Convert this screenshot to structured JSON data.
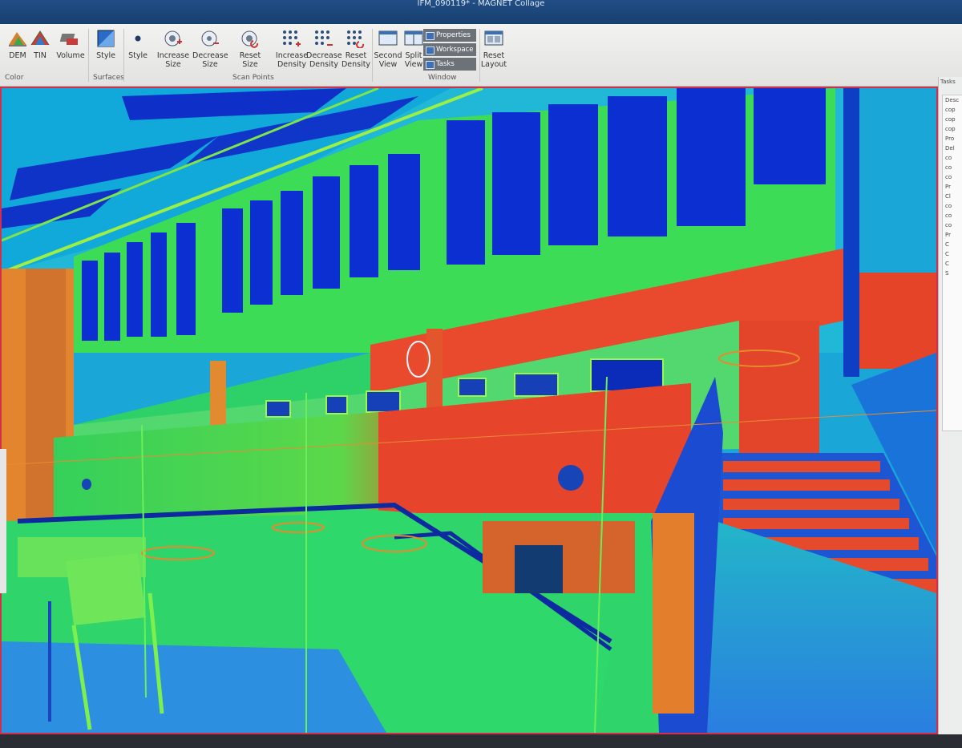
{
  "window": {
    "title": "IFM_090119* - MAGNET Collage"
  },
  "ribbon": {
    "buttons": [
      {
        "id": "dem",
        "label": "DEM",
        "icon": "dem-icon"
      },
      {
        "id": "tin",
        "label": "TIN",
        "icon": "tin-icon"
      },
      {
        "id": "volume",
        "label": "Volume",
        "icon": "volume-icon"
      },
      {
        "id": "style_surfaces",
        "label": "Style",
        "icon": "style-surface-icon"
      },
      {
        "id": "style_points",
        "label": "Style",
        "icon": "point-style-icon"
      },
      {
        "id": "increase_size",
        "label": "Increase Size",
        "icon": "increase-size-icon"
      },
      {
        "id": "decrease_size",
        "label": "Decrease Size",
        "icon": "decrease-size-icon"
      },
      {
        "id": "reset_size",
        "label": "Reset Size",
        "icon": "reset-size-icon"
      },
      {
        "id": "increase_density",
        "label": "Increase Density",
        "icon": "increase-density-icon"
      },
      {
        "id": "decrease_density",
        "label": "Decrease Density",
        "icon": "decrease-density-icon"
      },
      {
        "id": "reset_density",
        "label": "Reset Density",
        "icon": "reset-density-icon"
      },
      {
        "id": "second_view",
        "label": "Second View",
        "icon": "second-view-icon"
      },
      {
        "id": "split_view",
        "label": "Split View",
        "icon": "split-view-icon"
      },
      {
        "id": "reset_layout",
        "label": "Reset Layout",
        "icon": "reset-layout-icon"
      }
    ],
    "window_list": [
      "Properties",
      "Workspace",
      "Tasks"
    ],
    "groups": {
      "color": "Color",
      "surfaces": "Surfaces",
      "scan_points": "Scan Points",
      "window": "Window"
    }
  },
  "tasks_panel": {
    "title": "Tasks",
    "items": [
      "Desc",
      "cop",
      "cop",
      "cop",
      "Pro",
      "Del",
      "co",
      "co",
      "co",
      "Pr",
      "Cl",
      "co",
      "co",
      "co",
      "Pr",
      "C",
      "C",
      "C",
      "S"
    ]
  },
  "viewport": {
    "label": "scan point cloud view"
  },
  "colors": {
    "accent_red": "#d0304a",
    "ribbon_bg": "#ecedeb",
    "titlebar": "#1b4a80"
  }
}
